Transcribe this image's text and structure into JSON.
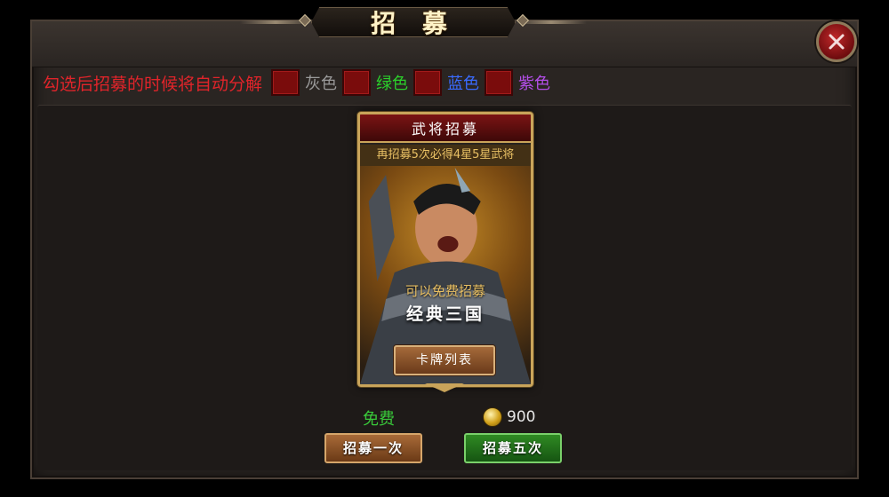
{
  "header": {
    "title": "招 募"
  },
  "filter": {
    "label": "勾选后招募的时候将自动分解",
    "options": [
      {
        "label": "灰色",
        "color": "#9a9a9a",
        "checked": false
      },
      {
        "label": "绿色",
        "color": "#2bd02b",
        "checked": false
      },
      {
        "label": "蓝色",
        "color": "#3a6bff",
        "checked": false
      },
      {
        "label": "紫色",
        "color": "#b34ee8",
        "checked": false
      }
    ]
  },
  "card": {
    "title": "武将招募",
    "subtitle": "再招募5次必得4星5星武将",
    "free_text": "可以免费招募",
    "name": "经典三国",
    "list_button": "卡牌列表"
  },
  "recruit": {
    "once": {
      "cost_label": "免费",
      "button": "招募一次"
    },
    "five": {
      "cost_value": "900",
      "cost_icon": "gold-ingot-icon",
      "button": "招募五次"
    }
  },
  "colors": {
    "accent_gold": "#c9a45a",
    "red": "#e0242a",
    "green_button": "#2f8a23"
  }
}
